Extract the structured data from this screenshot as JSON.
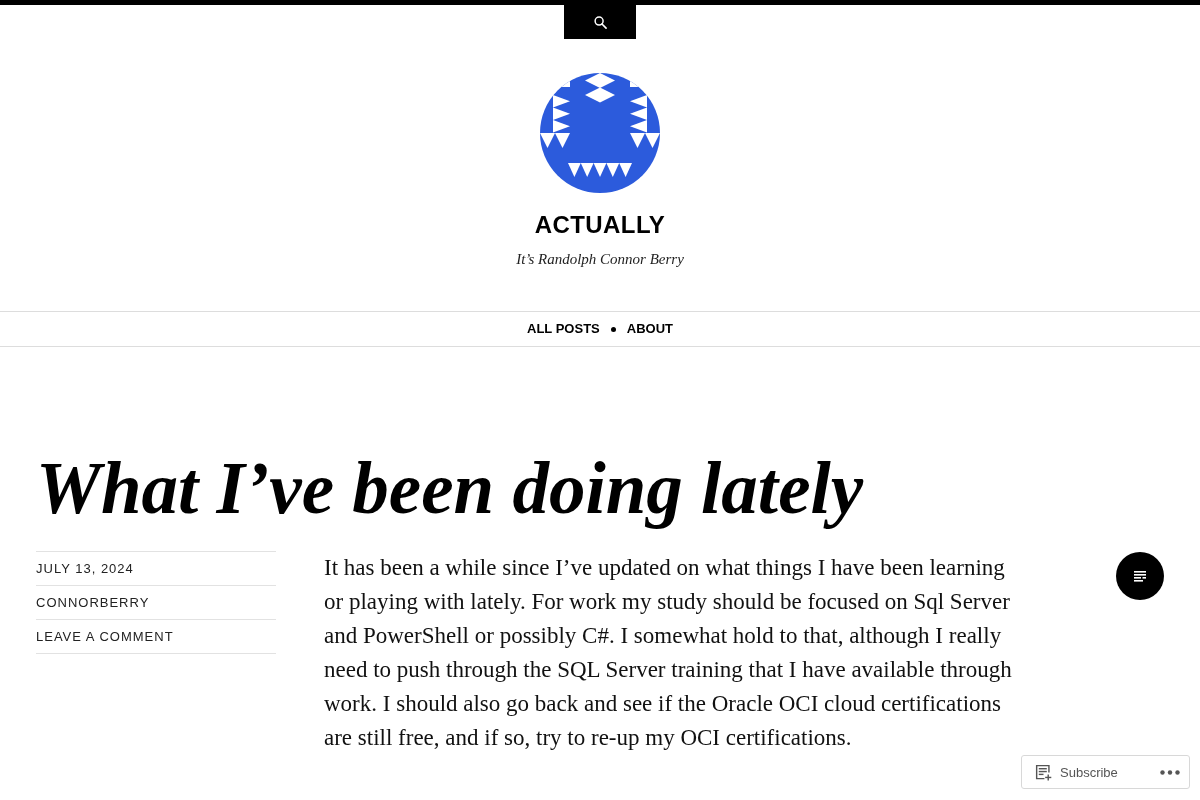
{
  "site": {
    "title": "ACTUALLY",
    "tagline": "It’s Randolph Connor Berry"
  },
  "nav": {
    "items": [
      {
        "label": "ALL POSTS"
      },
      {
        "label": "ABOUT"
      }
    ]
  },
  "post": {
    "title": "What I’ve been doing lately",
    "meta": [
      "JULY 13, 2024",
      "CONNORBERRY",
      "LEAVE A COMMENT"
    ],
    "paragraphs": [
      "It has been a while since I’ve updated on what things I have been learning or playing with lately. For work my study should be focused on Sql Server and PowerShell or possibly C#. I somewhat hold to that, although I really need to push through the SQL Server training that I have available through work. I should also go back and see if the Oracle OCI cloud certifications are still free, and if so, try to re-up my OCI certifications."
    ]
  },
  "subscribe_bar": {
    "label": "Subscribe"
  }
}
